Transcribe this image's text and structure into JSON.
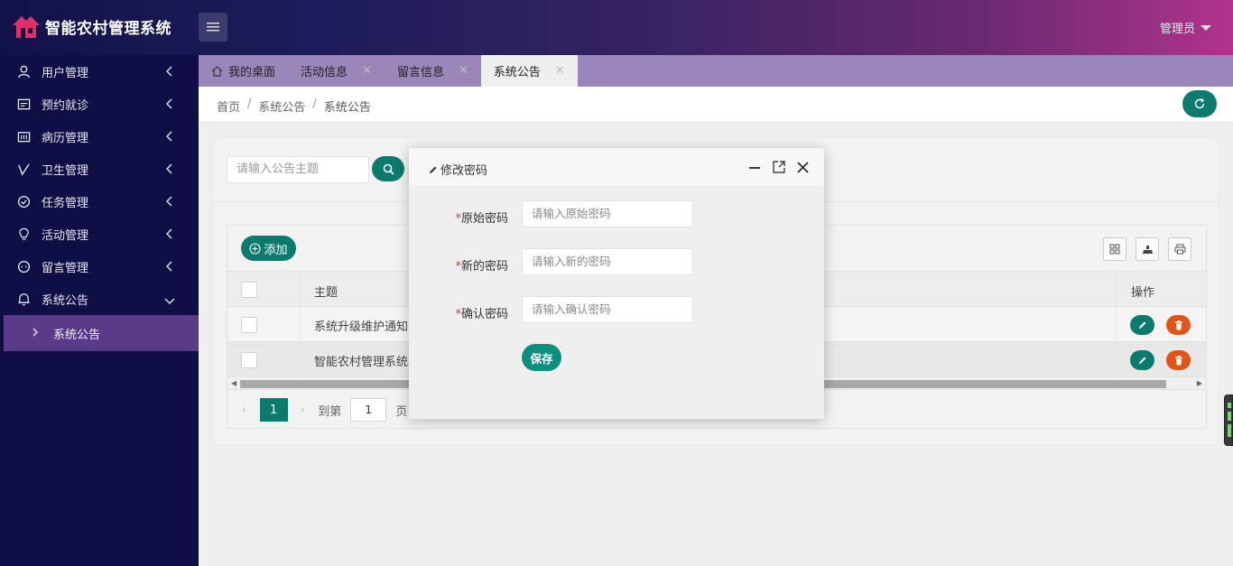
{
  "app": {
    "title": "智能农村管理系统",
    "user": "管理员"
  },
  "sidebar": {
    "items": [
      {
        "label": "用户管理",
        "icon": "user-icon"
      },
      {
        "label": "预约就诊",
        "icon": "calendar-icon"
      },
      {
        "label": "病历管理",
        "icon": "record-icon"
      },
      {
        "label": "卫生管理",
        "icon": "check-icon"
      },
      {
        "label": "任务管理",
        "icon": "task-icon"
      },
      {
        "label": "活动管理",
        "icon": "bulb-icon"
      },
      {
        "label": "留言管理",
        "icon": "chat-icon"
      },
      {
        "label": "系统公告",
        "icon": "bell-icon"
      }
    ],
    "sub_item": "系统公告"
  },
  "tabs": [
    {
      "label": "我的桌面"
    },
    {
      "label": "活动信息"
    },
    {
      "label": "留言信息"
    },
    {
      "label": "系统公告"
    }
  ],
  "breadcrumb": {
    "home": "首页",
    "parent": "系统公告",
    "current": "系统公告",
    "sep": "/"
  },
  "search": {
    "placeholder": "请输入公告主题"
  },
  "toolbar": {
    "add_label": "添加"
  },
  "table": {
    "headers": {
      "subject": "主题",
      "ops": "操作"
    },
    "rows": [
      {
        "subject": "系统升级维护通知"
      },
      {
        "subject": "智能农村管理系统上"
      }
    ]
  },
  "pager": {
    "current": "1",
    "goto_label": "到第",
    "goto_value": "1",
    "unit": "页"
  },
  "modal": {
    "title": "修改密码",
    "fields": [
      {
        "label": "原始密码",
        "placeholder": "请输入原始密码"
      },
      {
        "label": "新的密码",
        "placeholder": "请输入新的密码"
      },
      {
        "label": "确认密码",
        "placeholder": "请输入确认密码"
      }
    ],
    "required_mark": "*",
    "save_label": "保存"
  },
  "colors": {
    "primary": "#0d7a6e",
    "danger": "#e0561a",
    "sidebar": "#0f0f45",
    "sidebar_active": "#5a3b8a"
  }
}
